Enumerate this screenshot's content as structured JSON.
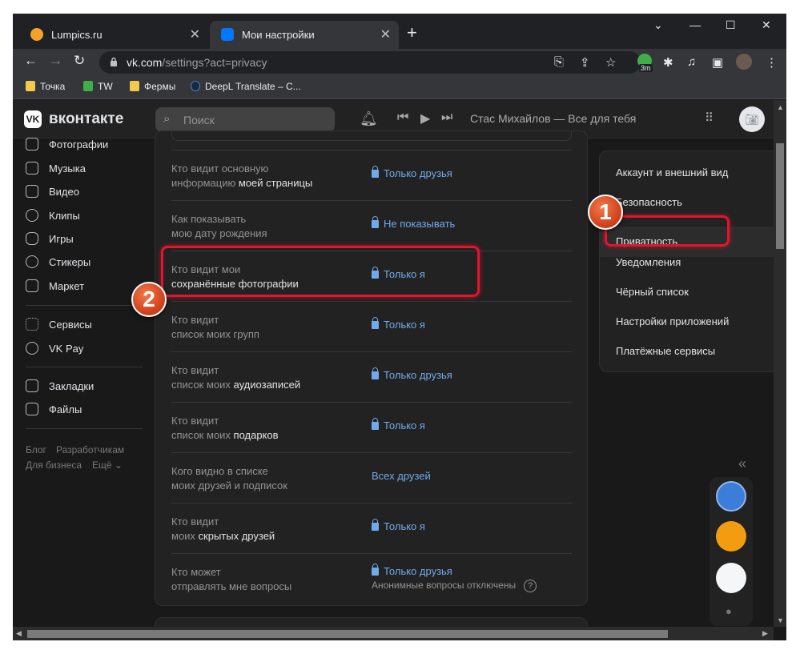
{
  "browser": {
    "tabs": [
      {
        "title": "Lumpics.ru",
        "active": false,
        "icon": "lumpics-favicon",
        "color": "#f4a12b"
      },
      {
        "title": "Мои настройки",
        "active": true,
        "icon": "vk-favicon",
        "color": "#0077ff"
      }
    ],
    "url_host": "vk.com",
    "url_path": "/settings?act=privacy",
    "extension_badge": "3m",
    "bookmarks": [
      {
        "label": "Точка",
        "icon": "folder-icon",
        "color": "#f2c94c"
      },
      {
        "label": "TW",
        "icon": "tw-icon",
        "color": "#3fae49"
      },
      {
        "label": "Фермы",
        "icon": "folder-icon",
        "color": "#f2c94c"
      },
      {
        "label": "DeepL Translate – C...",
        "icon": "deepl-icon",
        "color": "#0f2b46"
      }
    ]
  },
  "vk": {
    "logo_text": "вконтакте",
    "search_placeholder": "Поиск",
    "now_playing": "Стас Михайлов — Все для тебя"
  },
  "sidebar": {
    "items": [
      {
        "label": "Фотографии",
        "icon": "photos-icon"
      },
      {
        "label": "Музыка",
        "icon": "music-icon"
      },
      {
        "label": "Видео",
        "icon": "video-icon"
      },
      {
        "label": "Клипы",
        "icon": "clips-icon"
      },
      {
        "label": "Игры",
        "icon": "games-icon"
      },
      {
        "label": "Стикеры",
        "icon": "stickers-icon"
      },
      {
        "label": "Маркет",
        "icon": "market-icon"
      },
      {
        "label": "Сервисы",
        "icon": "services-icon"
      },
      {
        "label": "VK Pay",
        "icon": "vkpay-icon"
      },
      {
        "label": "Закладки",
        "icon": "bookmarks-icon"
      },
      {
        "label": "Файлы",
        "icon": "files-icon"
      }
    ],
    "footer": {
      "blog": "Блог",
      "developers": "Разработчикам",
      "business": "Для бизнеса",
      "more": "Ещё ⌄"
    }
  },
  "privacy": {
    "rows": [
      {
        "q1": "Кто видит основную",
        "q2a": "информацию ",
        "q2b": "моей страницы",
        "value": "Только друзья",
        "lock": true
      },
      {
        "q1": "Как показывать",
        "q2a": "мою дату рождения",
        "q2b": "",
        "value": "Не показывать",
        "lock": true
      },
      {
        "q1": "Кто видит мои",
        "q2a": "",
        "q2b": "сохранённые фотографии",
        "value": "Только я",
        "lock": true
      },
      {
        "q1": "Кто видит",
        "q2a": "список моих групп",
        "q2b": "",
        "value": "Только я",
        "lock": true
      },
      {
        "q1": "Кто видит",
        "q2a": "список моих ",
        "q2b": "аудиозаписей",
        "value": "Только друзья",
        "lock": true
      },
      {
        "q1": "Кто видит",
        "q2a": "список моих ",
        "q2b": "подарков",
        "value": "Только я",
        "lock": true
      },
      {
        "q1": "Кого видно в списке",
        "q2a": "моих друзей и подписок",
        "q2b": "",
        "value": "Всех друзей",
        "lock": false
      },
      {
        "q1": "Кто видит",
        "q2a": "моих ",
        "q2b": "скрытых друзей",
        "value": "Только я",
        "lock": true
      },
      {
        "q1": "Кто может",
        "q2a": "отправлять мне вопросы",
        "q2b": "",
        "value": "Только друзья",
        "lock": true,
        "sub": "Анонимные вопросы отключены",
        "help": "?"
      }
    ]
  },
  "settings_menu": {
    "items": [
      "Аккаунт и внешний вид",
      "Безопасность",
      "Приватность",
      "Уведомления",
      "Чёрный список",
      "Настройки приложений",
      "Платёжные сервисы"
    ],
    "selected": "Приватность"
  },
  "annotations": {
    "badge1": "1",
    "badge2": "2"
  },
  "colors": {
    "accent_link": "#71aaeb",
    "highlight": "#e1152b",
    "badge": "#d4461d"
  }
}
